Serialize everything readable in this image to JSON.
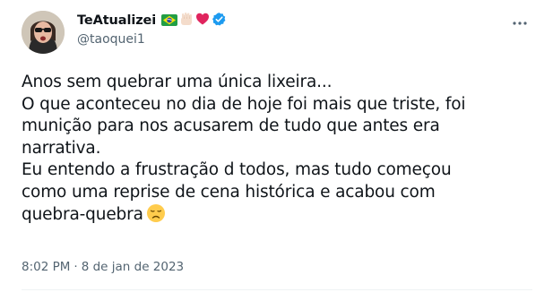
{
  "author": {
    "display_name": "TeAtualizei",
    "handle": "@taoquei1",
    "badges": [
      "brazil-flag-icon",
      "hand-icon",
      "red-heart-icon",
      "verified-icon"
    ]
  },
  "tweet": {
    "lines": [
      "Anos sem quebrar uma única lixeira...",
      "O que aconteceu no dia de hoje foi mais que triste, foi",
      "munição para nos acusarem de tudo que antes era",
      "narrativa.",
      "Eu entendo a frustração d todos, mas tudo começou",
      "como uma reprise de cena histórica e acabou com",
      "quebra-quebra"
    ],
    "trailing_emoji": "disappointed-face-icon"
  },
  "meta": {
    "time": "8:02 PM",
    "separator": "·",
    "date": "8 de jan de 2023"
  },
  "colors": {
    "text": "#0f1419",
    "secondary": "#536471",
    "verified": "#1d9bf0",
    "heart": "#e0245e",
    "divider": "#eff3f4"
  }
}
